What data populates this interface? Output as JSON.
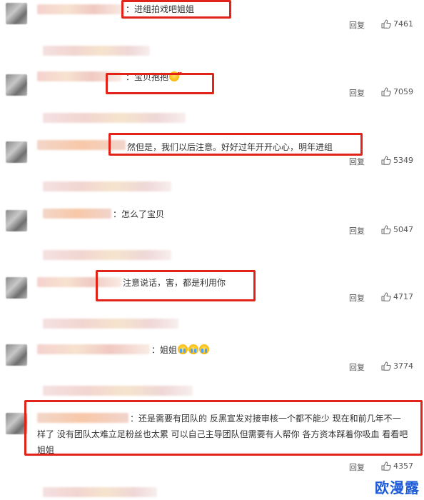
{
  "comments": [
    {
      "text": "：进组拍戏吧姐姐",
      "reply": "回复",
      "likes": "7461"
    },
    {
      "text": "：宝贝抱抱",
      "reply": "回复",
      "likes": "7059"
    },
    {
      "text": "然但是，我们以后注意。好好过年开开心心，明年进组",
      "reply": "回复",
      "likes": "5349"
    },
    {
      "text": "：怎么了宝贝",
      "reply": "回复",
      "likes": "5047"
    },
    {
      "text": "注意说话，害，都是利用你",
      "reply": "回复",
      "likes": "4717"
    },
    {
      "text": "：姐姐",
      "reply": "回复",
      "likes": "3774"
    },
    {
      "text_line1": "：还是需要有团队的 反黑宣发对接审核一个都不能少 现在和前几年不一",
      "text_line2": "样了 没有团队太难立足粉丝也太累 可以自己主导团队但需要有人帮你 各方资本踩着你吸血 看看吧",
      "text_line3": "姐姐",
      "reply": "回复",
      "likes": "4357"
    }
  ],
  "icons": {
    "like": "thumbs-up-icon",
    "emoji_hug": "hug-emoji-icon",
    "emoji_cry": "crying-emoji-icon"
  },
  "accent_color": "#e2231a",
  "watermark": "欧漫露"
}
